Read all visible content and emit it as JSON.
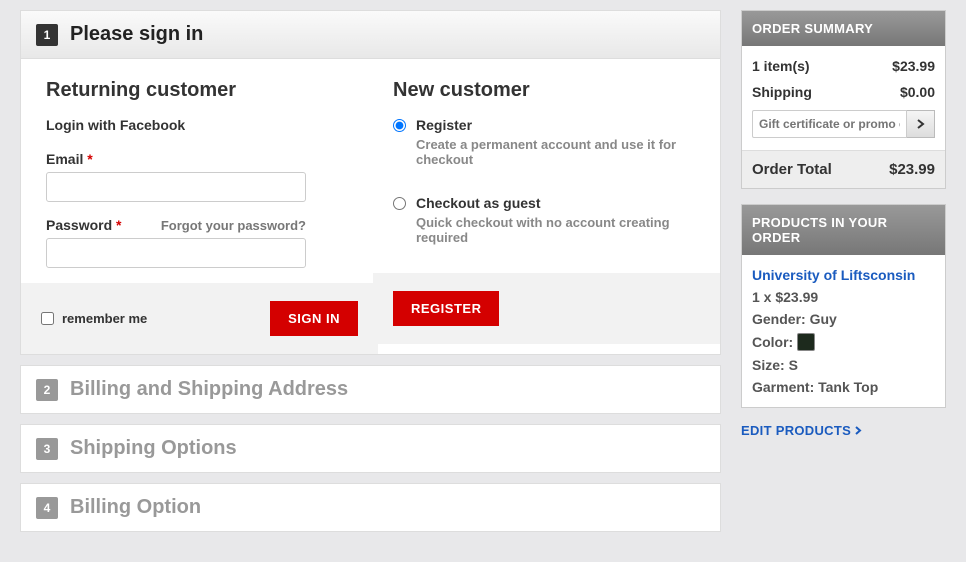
{
  "steps": {
    "s1": {
      "num": "1",
      "title": "Please sign in"
    },
    "s2": {
      "num": "2",
      "title": "Billing and Shipping Address"
    },
    "s3": {
      "num": "3",
      "title": "Shipping Options"
    },
    "s4": {
      "num": "4",
      "title": "Billing Option"
    }
  },
  "returning": {
    "heading": "Returning customer",
    "fb": "Login with Facebook",
    "email_label": "Email",
    "password_label": "Password",
    "forgot": "Forgot your password?",
    "remember": "remember me",
    "signin": "SIGN IN"
  },
  "newcust": {
    "heading": "New customer",
    "register_label": "Register",
    "register_desc": "Create a permanent account and use it for checkout",
    "guest_label": "Checkout as guest",
    "guest_desc": "Quick checkout with no account creating required",
    "register_btn": "REGISTER"
  },
  "summary": {
    "head": "ORDER SUMMARY",
    "items_label": "1 item(s)",
    "items_value": "$23.99",
    "shipping_label": "Shipping",
    "shipping_value": "$0.00",
    "promo_placeholder": "Gift certificate or promo code",
    "total_label": "Order Total",
    "total_value": "$23.99"
  },
  "products": {
    "head": "PRODUCTS IN YOUR ORDER",
    "name": "University of Liftsconsin",
    "qty_price": "1 x $23.99",
    "gender": "Gender: Guy",
    "color_label": "Color:",
    "color_hex": "#1d2a1d",
    "size": "Size: S",
    "garment": "Garment: Tank Top",
    "edit": "EDIT PRODUCTS"
  }
}
